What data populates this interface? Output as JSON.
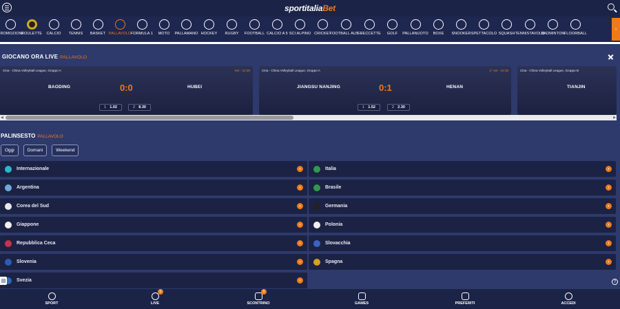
{
  "header": {
    "logo_main": "sportitalia",
    "logo_accent": "Bet",
    "menu_icon": "menu-icon",
    "search_icon": "search-icon"
  },
  "sports": [
    {
      "label": "Promozioni",
      "icon": "gift-icon"
    },
    {
      "label": "Roulette",
      "icon": "roulette-icon"
    },
    {
      "label": "Calcio",
      "icon": "soccer-ball-icon"
    },
    {
      "label": "Tennis",
      "icon": "tennis-ball-icon"
    },
    {
      "label": "Basket",
      "icon": "basketball-icon"
    },
    {
      "label": "Pallavolo",
      "icon": "volleyball-icon",
      "selected": true
    },
    {
      "label": "Formula 1",
      "icon": "f1-helmet-icon"
    },
    {
      "label": "Moto",
      "icon": "trophy-icon"
    },
    {
      "label": "Pallamano",
      "icon": "handball-icon"
    },
    {
      "label": "Hockey",
      "icon": "hockey-sticks-icon"
    },
    {
      "label": "Rugby",
      "icon": "rugby-ball-icon"
    },
    {
      "label": "Football",
      "icon": "american-football-icon"
    },
    {
      "label": "Calcio a 5",
      "icon": "futsal-ball-icon"
    },
    {
      "label": "Sci alpino",
      "icon": "ski-goggles-icon"
    },
    {
      "label": "Cricket",
      "icon": "cricket-bat-icon"
    },
    {
      "label": "Football Aus...",
      "icon": "aussie-football-icon"
    },
    {
      "label": "Freccette",
      "icon": "dart-icon"
    },
    {
      "label": "Golf",
      "icon": "golf-icon"
    },
    {
      "label": "Pallanuoto",
      "icon": "waterpolo-ball-icon"
    },
    {
      "label": "Boxe",
      "icon": "boxing-glove-icon"
    },
    {
      "label": "Snooker",
      "icon": "snooker-ball-icon"
    },
    {
      "label": "Spettacolo",
      "icon": "star-icon"
    },
    {
      "label": "Squash",
      "icon": "squash-racket-icon"
    },
    {
      "label": "Tennistavolo",
      "icon": "table-tennis-icon"
    },
    {
      "label": "Badminton",
      "icon": "shuttlecock-icon"
    },
    {
      "label": "Floorball",
      "icon": "floorball-icon"
    }
  ],
  "sports_more": "›",
  "live": {
    "title": "GIOCANO ORA LIVE",
    "subtitle": "PALLAVOLO",
    "matches": [
      {
        "league": "Cina - China Volleyball League, Gruppo A",
        "time": "Set - 12:36",
        "home": "BAODING",
        "away": "HUBEI",
        "score": "0:0",
        "odds": [
          {
            "k": "1",
            "v": "1.02"
          },
          {
            "k": "2",
            "v": "8.30"
          }
        ]
      },
      {
        "league": "Cina - China Volleyball League, Gruppo A",
        "time": "2° set - 12:36",
        "home": "JIANGSU NANJING",
        "away": "HENAN",
        "score": "0:1",
        "odds": [
          {
            "k": "1",
            "v": "1.52"
          },
          {
            "k": "2",
            "v": "2.30"
          }
        ]
      },
      {
        "league": "Cina - China Volleyball League, Gruppo B",
        "time": "",
        "home": "TIANJIN",
        "away": "",
        "score": "",
        "odds": []
      }
    ]
  },
  "palinsesto": {
    "title": "PALINSESTO",
    "subtitle": "PALLAVOLO",
    "filters": [
      "Oggi",
      "Domani",
      "Weekend"
    ],
    "left": [
      "Internazionale",
      "Argentina",
      "Corea del Sud",
      "Giappone",
      "Repubblica Ceca",
      "Slovenia",
      "Svezia"
    ],
    "right": [
      "Italia",
      "Brasile",
      "Germania",
      "Polonia",
      "Slovacchia",
      "Spagna"
    ],
    "arrow": "›"
  },
  "bottom_nav": [
    {
      "label": "SPORT",
      "icon": "soccer-ball-icon",
      "badge": ""
    },
    {
      "label": "LIVE",
      "icon": "live-broadcast-icon",
      "badge": "0"
    },
    {
      "label": "SCONTRINO",
      "icon": "receipt-icon",
      "badge": "0"
    },
    {
      "label": "GAMES",
      "icon": "casino-icon",
      "badge": ""
    },
    {
      "label": "PREFERITI",
      "icon": "star-icon",
      "badge": ""
    },
    {
      "label": "ACCEDI",
      "icon": "user-icon",
      "badge": ""
    }
  ],
  "colors": {
    "accent": "#f07a1a",
    "header": "#1b2347",
    "background": "#2e3a6b",
    "card": "#1c2244"
  }
}
